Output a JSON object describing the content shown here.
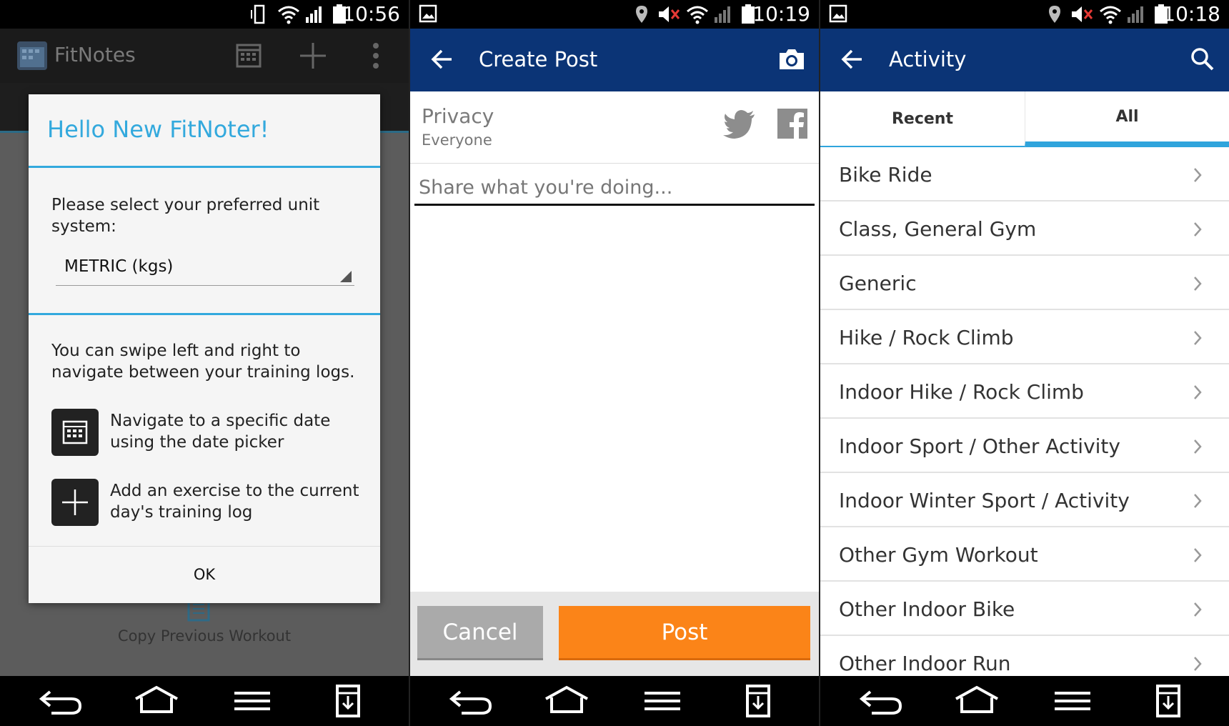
{
  "panels": {
    "fitnotes": {
      "status_time": "10:56",
      "app_title": "FitNotes",
      "dialog": {
        "title": "Hello New FitNoter!",
        "unit_prompt": "Please select your preferred unit system:",
        "unit_value": "METRIC (kgs)",
        "swipe_text": "You can swipe left and right to navigate between your training logs.",
        "tip_date": "Navigate to a specific date using the date picker",
        "tip_add": "Add an exercise to the current day's training log",
        "ok_label": "OK"
      },
      "background_label": "Copy Previous Workout"
    },
    "create_post": {
      "status_time": "10:19",
      "title": "Create Post",
      "privacy_label": "Privacy",
      "privacy_value": "Everyone",
      "share_placeholder": "Share what you're doing...",
      "cancel_label": "Cancel",
      "post_label": "Post"
    },
    "activity": {
      "status_time": "10:18",
      "title": "Activity",
      "tabs": [
        "Recent",
        "All"
      ],
      "items": [
        "Bike Ride",
        "Class, General Gym",
        "Generic",
        "Hike / Rock Climb",
        "Indoor Hike / Rock Climb",
        "Indoor Sport / Other Activity",
        "Indoor Winter Sport / Activity",
        "Other Gym Workout",
        "Other Indoor Bike",
        "Other Indoor Run"
      ]
    }
  },
  "colors": {
    "fitnotes_accent": "#33a9dd",
    "garmin_bar": "#0b3476",
    "post_orange": "#fb8418",
    "tab_indicator": "#2fa4dc"
  }
}
